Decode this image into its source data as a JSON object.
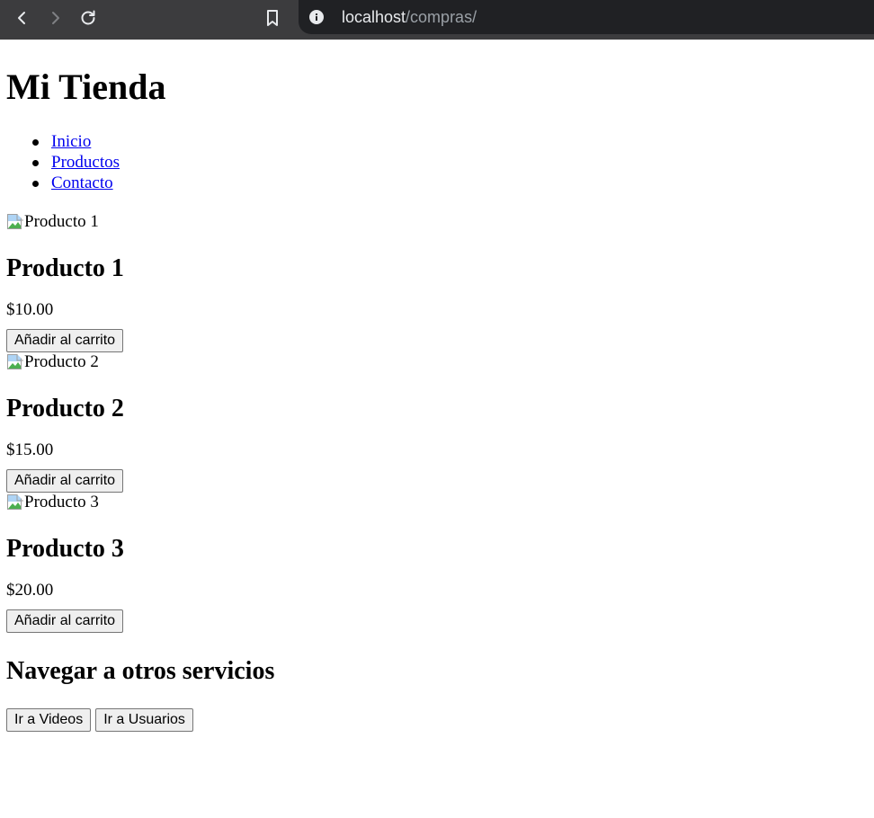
{
  "browser": {
    "url_host": "localhost",
    "url_path": "/compras/"
  },
  "site": {
    "title": "Mi Tienda"
  },
  "nav": {
    "items": [
      {
        "label": "Inicio"
      },
      {
        "label": "Productos"
      },
      {
        "label": "Contacto"
      }
    ]
  },
  "products": [
    {
      "image_alt": "Producto 1",
      "name": "Producto 1",
      "price": "$10.00",
      "button_label": "Añadir al carrito"
    },
    {
      "image_alt": "Producto 2",
      "name": "Producto 2",
      "price": "$15.00",
      "button_label": "Añadir al carrito"
    },
    {
      "image_alt": "Producto 3",
      "name": "Producto 3",
      "price": "$20.00",
      "button_label": "Añadir al carrito"
    }
  ],
  "services": {
    "title": "Navegar a otros servicios",
    "buttons": [
      {
        "label": "Ir a Videos"
      },
      {
        "label": "Ir a Usuarios"
      }
    ]
  },
  "colors": {
    "toolbar_bg": "#3c3c3e",
    "omnibox_bg": "#202124",
    "link": "#0000ee"
  }
}
